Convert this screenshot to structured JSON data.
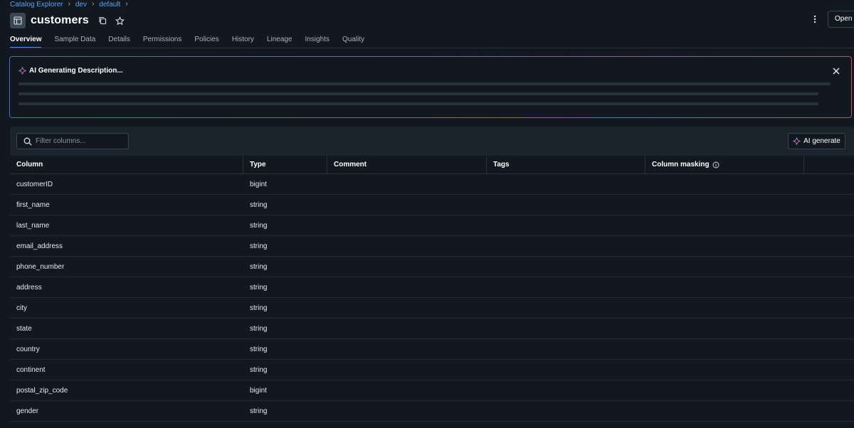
{
  "breadcrumb": [
    "Catalog Explorer",
    "dev",
    "default"
  ],
  "header": {
    "title": "customers",
    "open_label": "Open in"
  },
  "tabs": [
    {
      "label": "Overview",
      "active": true
    },
    {
      "label": "Sample Data"
    },
    {
      "label": "Details"
    },
    {
      "label": "Permissions"
    },
    {
      "label": "Policies"
    },
    {
      "label": "History"
    },
    {
      "label": "Lineage"
    },
    {
      "label": "Insights"
    },
    {
      "label": "Quality"
    }
  ],
  "ai_banner": {
    "title": "AI Generating Description..."
  },
  "toolbar": {
    "filter_placeholder": "Filter columns...",
    "ai_generate_label": "AI generate"
  },
  "table": {
    "headers": [
      "Column",
      "Type",
      "Comment",
      "Tags",
      "Column masking"
    ],
    "rows": [
      {
        "column": "customerID",
        "type": "bigint"
      },
      {
        "column": "first_name",
        "type": "string"
      },
      {
        "column": "last_name",
        "type": "string"
      },
      {
        "column": "email_address",
        "type": "string"
      },
      {
        "column": "phone_number",
        "type": "string"
      },
      {
        "column": "address",
        "type": "string"
      },
      {
        "column": "city",
        "type": "string"
      },
      {
        "column": "state",
        "type": "string"
      },
      {
        "column": "country",
        "type": "string"
      },
      {
        "column": "continent",
        "type": "string"
      },
      {
        "column": "postal_zip_code",
        "type": "bigint"
      },
      {
        "column": "gender",
        "type": "string"
      }
    ]
  },
  "colors": {
    "accent": "#4c8ee6",
    "link": "#5aa2f0",
    "background": "#111820",
    "ai_gradient": [
      "#3a6fd8",
      "#7c5cd6",
      "#d9455f"
    ]
  },
  "icons": [
    "table-icon",
    "copy-icon",
    "star-icon",
    "kebab-menu-icon",
    "sparkle-icon",
    "close-icon",
    "search-icon",
    "info-icon"
  ]
}
